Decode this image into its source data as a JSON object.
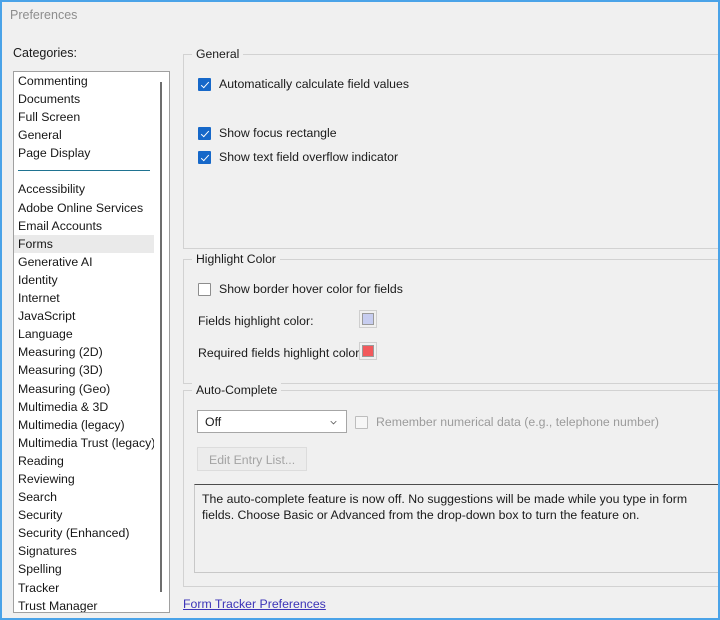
{
  "window": {
    "title": "Preferences",
    "accent_border_color": "#4aa3e8",
    "background_color": "#f0f0f0"
  },
  "sidebar": {
    "label": "Categories:",
    "selected": "Forms",
    "separator_color": "#1f7391",
    "selection_color": "#eaeaea",
    "group_one": [
      {
        "label": "Commenting"
      },
      {
        "label": "Documents"
      },
      {
        "label": "Full Screen"
      },
      {
        "label": "General"
      },
      {
        "label": "Page Display"
      }
    ],
    "group_two": [
      {
        "label": "Accessibility"
      },
      {
        "label": "Adobe Online Services"
      },
      {
        "label": "Email Accounts"
      },
      {
        "label": "Forms"
      },
      {
        "label": "Generative AI"
      },
      {
        "label": "Identity"
      },
      {
        "label": "Internet"
      },
      {
        "label": "JavaScript"
      },
      {
        "label": "Language"
      },
      {
        "label": "Measuring (2D)"
      },
      {
        "label": "Measuring (3D)"
      },
      {
        "label": "Measuring (Geo)"
      },
      {
        "label": "Multimedia & 3D"
      },
      {
        "label": "Multimedia (legacy)"
      },
      {
        "label": "Multimedia Trust (legacy)"
      },
      {
        "label": "Reading"
      },
      {
        "label": "Reviewing"
      },
      {
        "label": "Search"
      },
      {
        "label": "Security"
      },
      {
        "label": "Security (Enhanced)"
      },
      {
        "label": "Signatures"
      },
      {
        "label": "Spelling"
      },
      {
        "label": "Tracker"
      },
      {
        "label": "Trust Manager"
      }
    ]
  },
  "general": {
    "legend": "General",
    "auto_calculate": {
      "label": "Automatically calculate field values",
      "checked": true
    },
    "focus_rectangle": {
      "label": "Show focus rectangle",
      "checked": true
    },
    "overflow_indicator": {
      "label": "Show text field overflow indicator",
      "checked": true
    }
  },
  "highlight_color": {
    "legend": "Highlight Color",
    "border_hover": {
      "label": "Show border hover color for fields",
      "checked": false
    },
    "fields_label": "Fields highlight color:",
    "fields_swatch_color": "#c7cdf0",
    "required_label": "Required fields highlight color:",
    "required_swatch_color": "#f2595c"
  },
  "auto_complete": {
    "legend": "Auto-Complete",
    "mode_value": "Off",
    "remember_numerical": {
      "label": "Remember numerical data (e.g., telephone number)",
      "checked": false,
      "disabled": true
    },
    "edit_entry_list_label": "Edit Entry List...",
    "edit_entry_list_disabled": true,
    "description": "The auto-complete feature is now off. No suggestions will be made while you type in form fields. Choose Basic or Advanced from the drop-down box to turn the feature on."
  },
  "footer": {
    "link_label": "Form Tracker Preferences",
    "link_color": "#3c34b8"
  }
}
